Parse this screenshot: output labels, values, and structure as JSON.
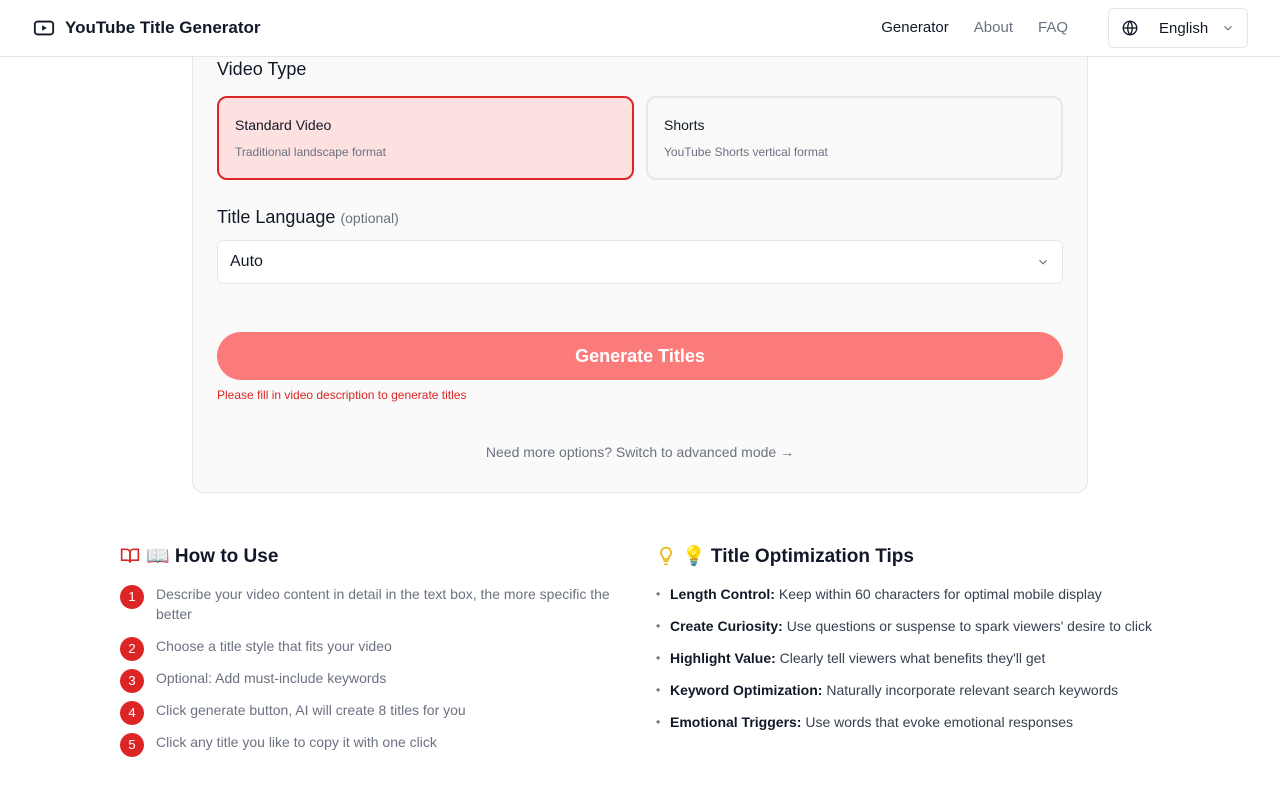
{
  "header": {
    "title": "YouTube Title Generator",
    "nav": [
      "Generator",
      "About",
      "FAQ"
    ],
    "language": "English"
  },
  "form": {
    "video_type_label": "Video Type",
    "video_types": [
      {
        "title": "Standard Video",
        "desc": "Traditional landscape format",
        "selected": true
      },
      {
        "title": "Shorts",
        "desc": "YouTube Shorts vertical format",
        "selected": false
      }
    ],
    "language_label": "Title Language",
    "language_optional": "(optional)",
    "language_value": "Auto",
    "generate_label": "Generate Titles",
    "error": "Please fill in video description to generate titles",
    "advanced_link": "Need more options? Switch to advanced mode →"
  },
  "how_to": {
    "heading": "📖 How to Use",
    "steps": [
      {
        "num": "1",
        "text": "Describe your video content in detail in the text box, the more specific the better"
      },
      {
        "num": "2",
        "text": "Choose a title style that fits your video"
      },
      {
        "num": "3",
        "text": "Optional: Add must-include keywords"
      },
      {
        "num": "4",
        "text": "Click generate button, AI will create 8 titles for you"
      },
      {
        "num": "5",
        "text": "Click any title you like to copy it with one click"
      }
    ]
  },
  "tips": {
    "heading": "💡 Title Optimization Tips",
    "items": [
      {
        "bold": "Length Control:",
        "text": "Keep within 60 characters for optimal mobile display"
      },
      {
        "bold": "Create Curiosity:",
        "text": "Use questions or suspense to spark viewers' desire to click"
      },
      {
        "bold": "Highlight Value:",
        "text": "Clearly tell viewers what benefits they'll get"
      },
      {
        "bold": "Keyword Optimization:",
        "text": "Naturally incorporate relevant search keywords"
      },
      {
        "bold": "Emotional Triggers:",
        "text": "Use words that evoke emotional responses"
      }
    ]
  },
  "colors": {
    "accent": "#dc2626",
    "button": "#fb7b7b",
    "selected_bg": "#fde0e0"
  }
}
